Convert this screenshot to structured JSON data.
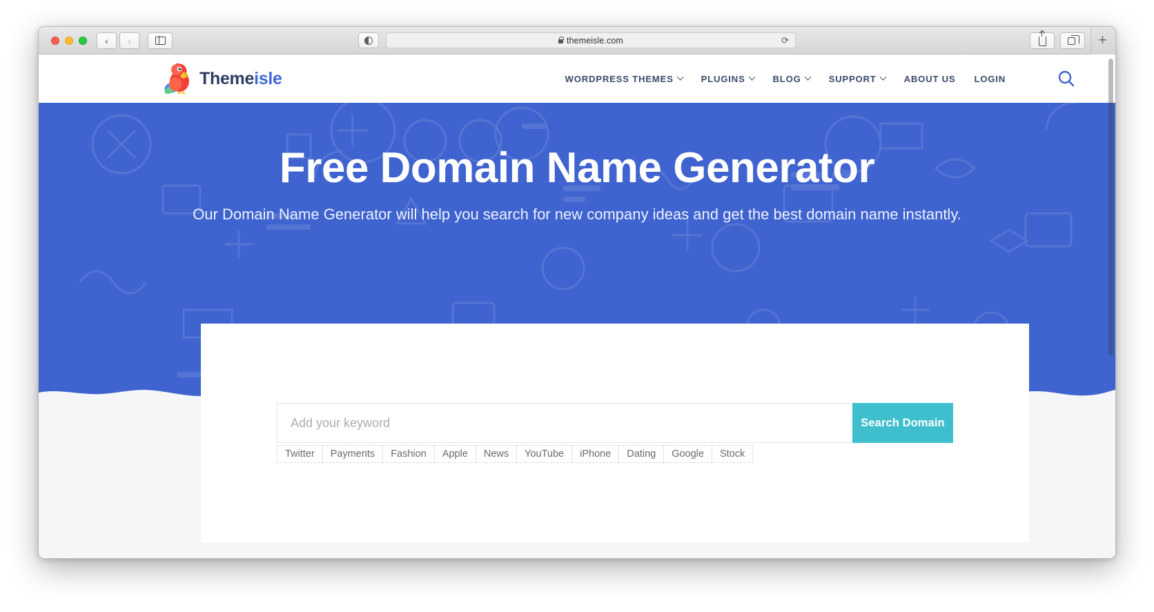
{
  "browser": {
    "window_controls": [
      "close",
      "minimize",
      "maximize"
    ],
    "back_label": "‹",
    "forward_label": "›",
    "sidebar_icon": "sidebar-icon",
    "reader_icon": "reader-view-icon",
    "lock_icon": "lock-icon",
    "url": "themeisle.com",
    "reload_label": "⟳",
    "share_icon": "share-icon",
    "tabs_icon": "tab-overview-icon",
    "new_tab_label": "+"
  },
  "site": {
    "logo": {
      "icon": "parrot-logo-icon",
      "text_dark": "Theme",
      "text_blue": "isle"
    },
    "nav": [
      {
        "label": "WORDPRESS THEMES",
        "has_dropdown": true
      },
      {
        "label": "PLUGINS",
        "has_dropdown": true
      },
      {
        "label": "BLOG",
        "has_dropdown": true
      },
      {
        "label": "SUPPORT",
        "has_dropdown": true
      },
      {
        "label": "ABOUT US",
        "has_dropdown": false
      },
      {
        "label": "LOGIN",
        "has_dropdown": false
      }
    ],
    "search_icon": "search-icon"
  },
  "hero": {
    "title": "Free Domain Name Generator",
    "subtitle": "Our Domain Name Generator will help you search for new company ideas and get the best domain name instantly.",
    "background_color": "#3f63cf"
  },
  "search_card": {
    "input_value": "",
    "input_placeholder": "Add your keyword",
    "submit_label": "Search Domain",
    "submit_color": "#3fbfcd",
    "suggestions": [
      "Twitter",
      "Payments",
      "Fashion",
      "Apple",
      "News",
      "YouTube",
      "iPhone",
      "Dating",
      "Google",
      "Stock"
    ]
  }
}
